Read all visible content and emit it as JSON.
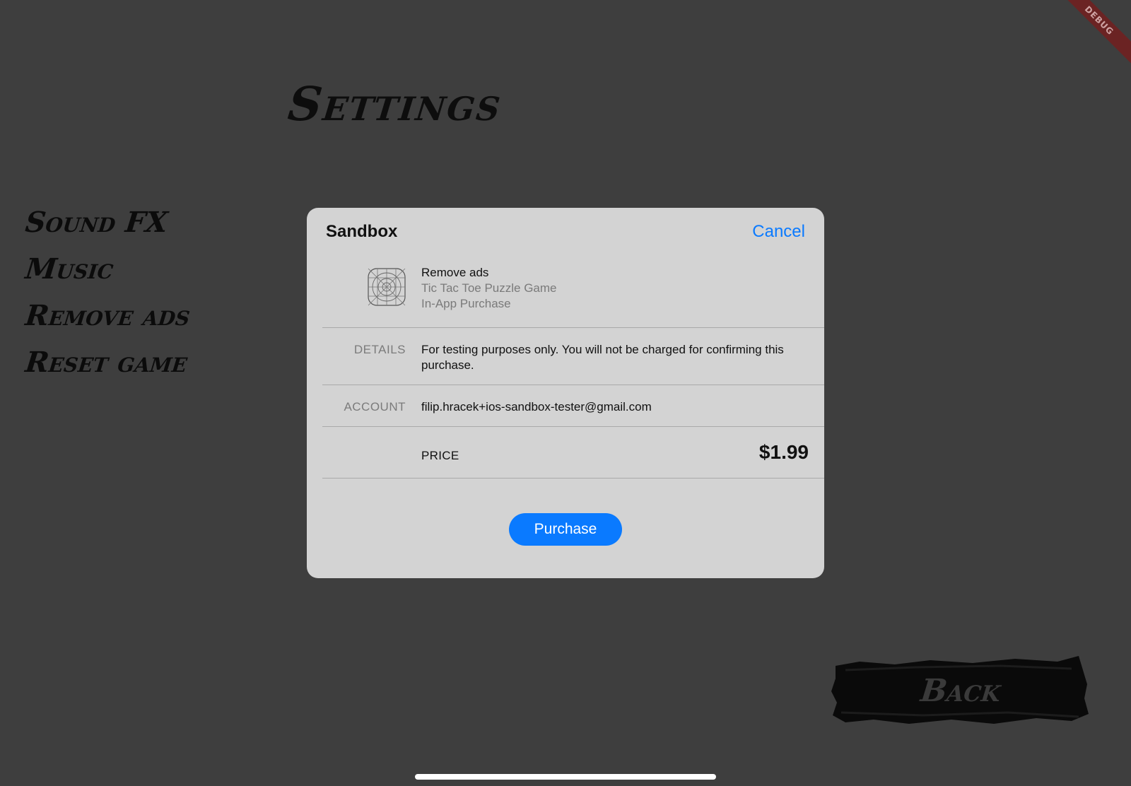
{
  "screen": {
    "title": "Settings",
    "debug_banner": "DEBUG",
    "menu": [
      {
        "label": "Sound FX"
      },
      {
        "label": "Music"
      },
      {
        "label": "Remove ads"
      },
      {
        "label": "Reset game"
      }
    ],
    "back_label": "Back"
  },
  "sheet": {
    "title": "Sandbox",
    "cancel_label": "Cancel",
    "product": {
      "name": "Remove ads",
      "app": "Tic Tac Toe Puzzle Game",
      "type": "In-App Purchase",
      "icon": "app-placeholder-icon"
    },
    "details": {
      "label": "DETAILS",
      "value": "For testing purposes only. You will not be charged for confirming this purchase."
    },
    "account": {
      "label": "ACCOUNT",
      "value": "filip.hracek+ios-sandbox-tester@gmail.com"
    },
    "price": {
      "label": "PRICE",
      "value": "$1.99"
    },
    "purchase_label": "Purchase"
  },
  "colors": {
    "background": "#3e3e3e",
    "sheet": "#d3d3d3",
    "accent": "#0a7aff",
    "brush_ink": "#0b0b0b"
  }
}
